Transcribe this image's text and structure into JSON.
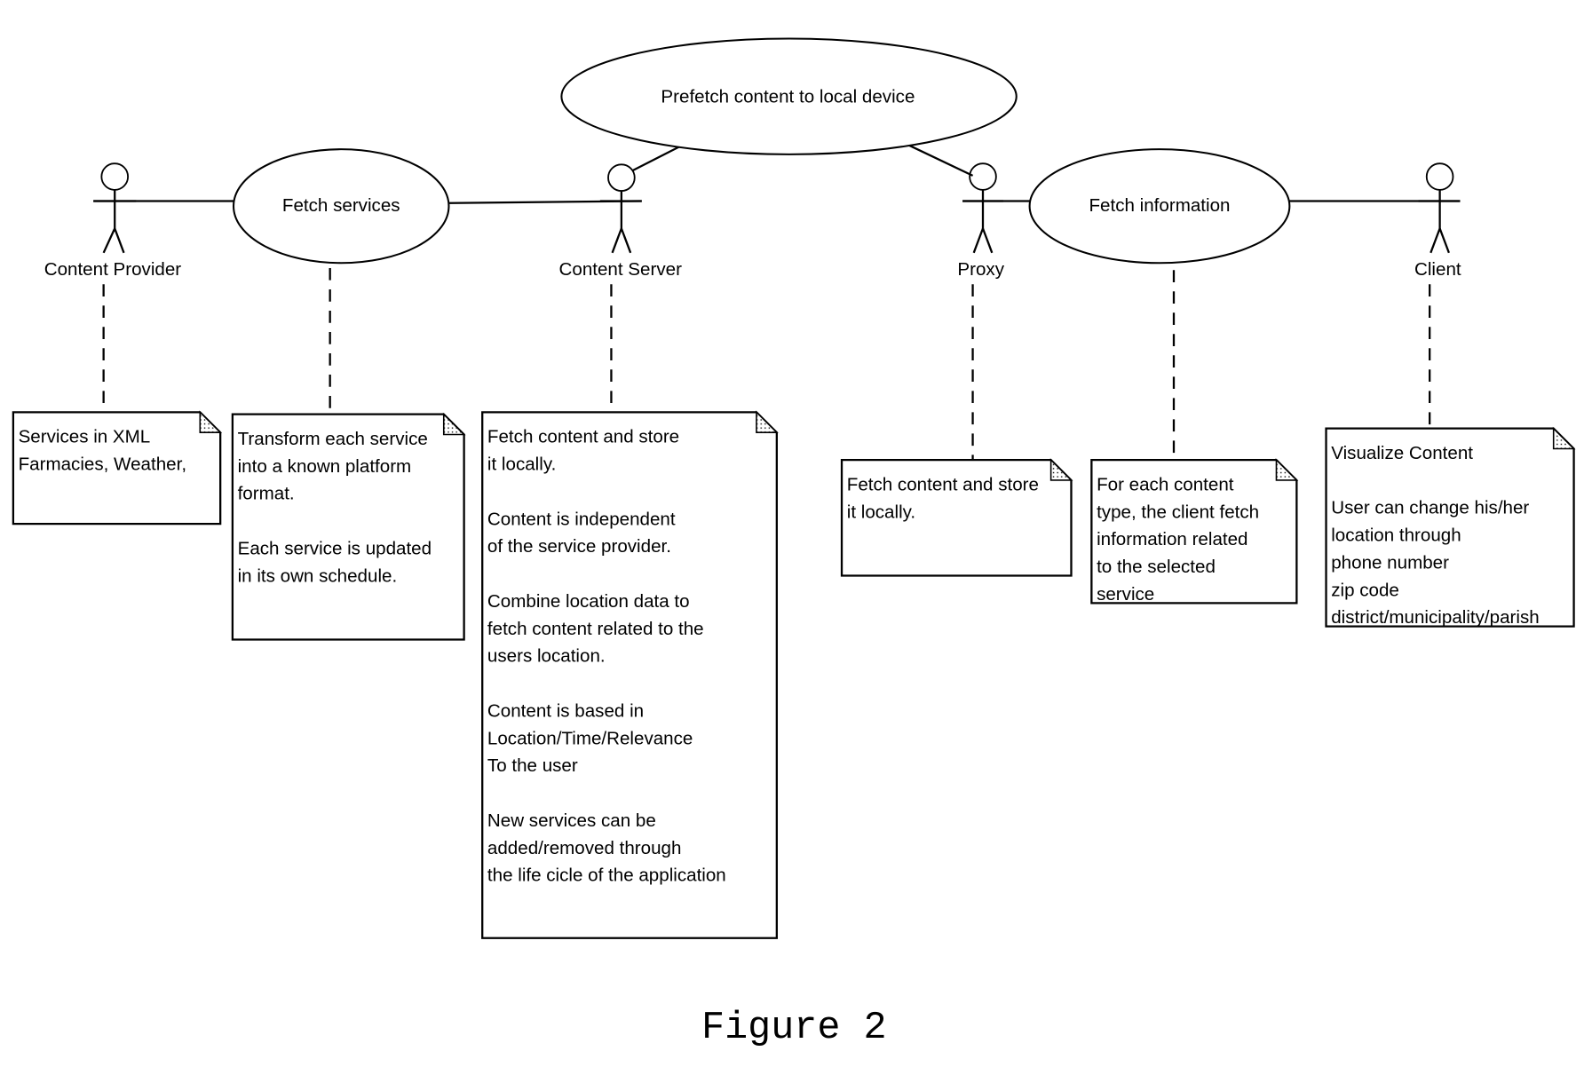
{
  "use_cases": {
    "prefetch": "Prefetch content to local device",
    "fetch_services": "Fetch services",
    "fetch_information": "Fetch information"
  },
  "actors": {
    "content_provider": "Content Provider",
    "content_server": "Content Server",
    "proxy": "Proxy",
    "client": "Client"
  },
  "notes": {
    "content_provider": [
      "Services in XML",
      "Farmacies, Weather,"
    ],
    "fetch_services": [
      "Transform each service",
      "into a known platform",
      "format.",
      "",
      "Each service is updated",
      "in its own schedule."
    ],
    "content_server": [
      "Fetch content and store",
      "it locally.",
      "",
      "Content is independent",
      "of the service provider.",
      "",
      "Combine location data to",
      "fetch content related to the",
      "users location.",
      "",
      "Content is based in",
      "Location/Time/Relevance",
      "To the user",
      "",
      "New services can be",
      "added/removed through",
      "the life cicle of the application"
    ],
    "proxy": [
      "Fetch content and store",
      "it locally."
    ],
    "fetch_information": [
      "For each content",
      "type, the client fetch",
      "information related",
      "to the selected",
      "service"
    ],
    "client": [
      "Visualize Content",
      "",
      "User can change his/her",
      "location through",
      "phone number",
      "zip code",
      "district/municipality/parish"
    ]
  },
  "caption": "Figure 2"
}
